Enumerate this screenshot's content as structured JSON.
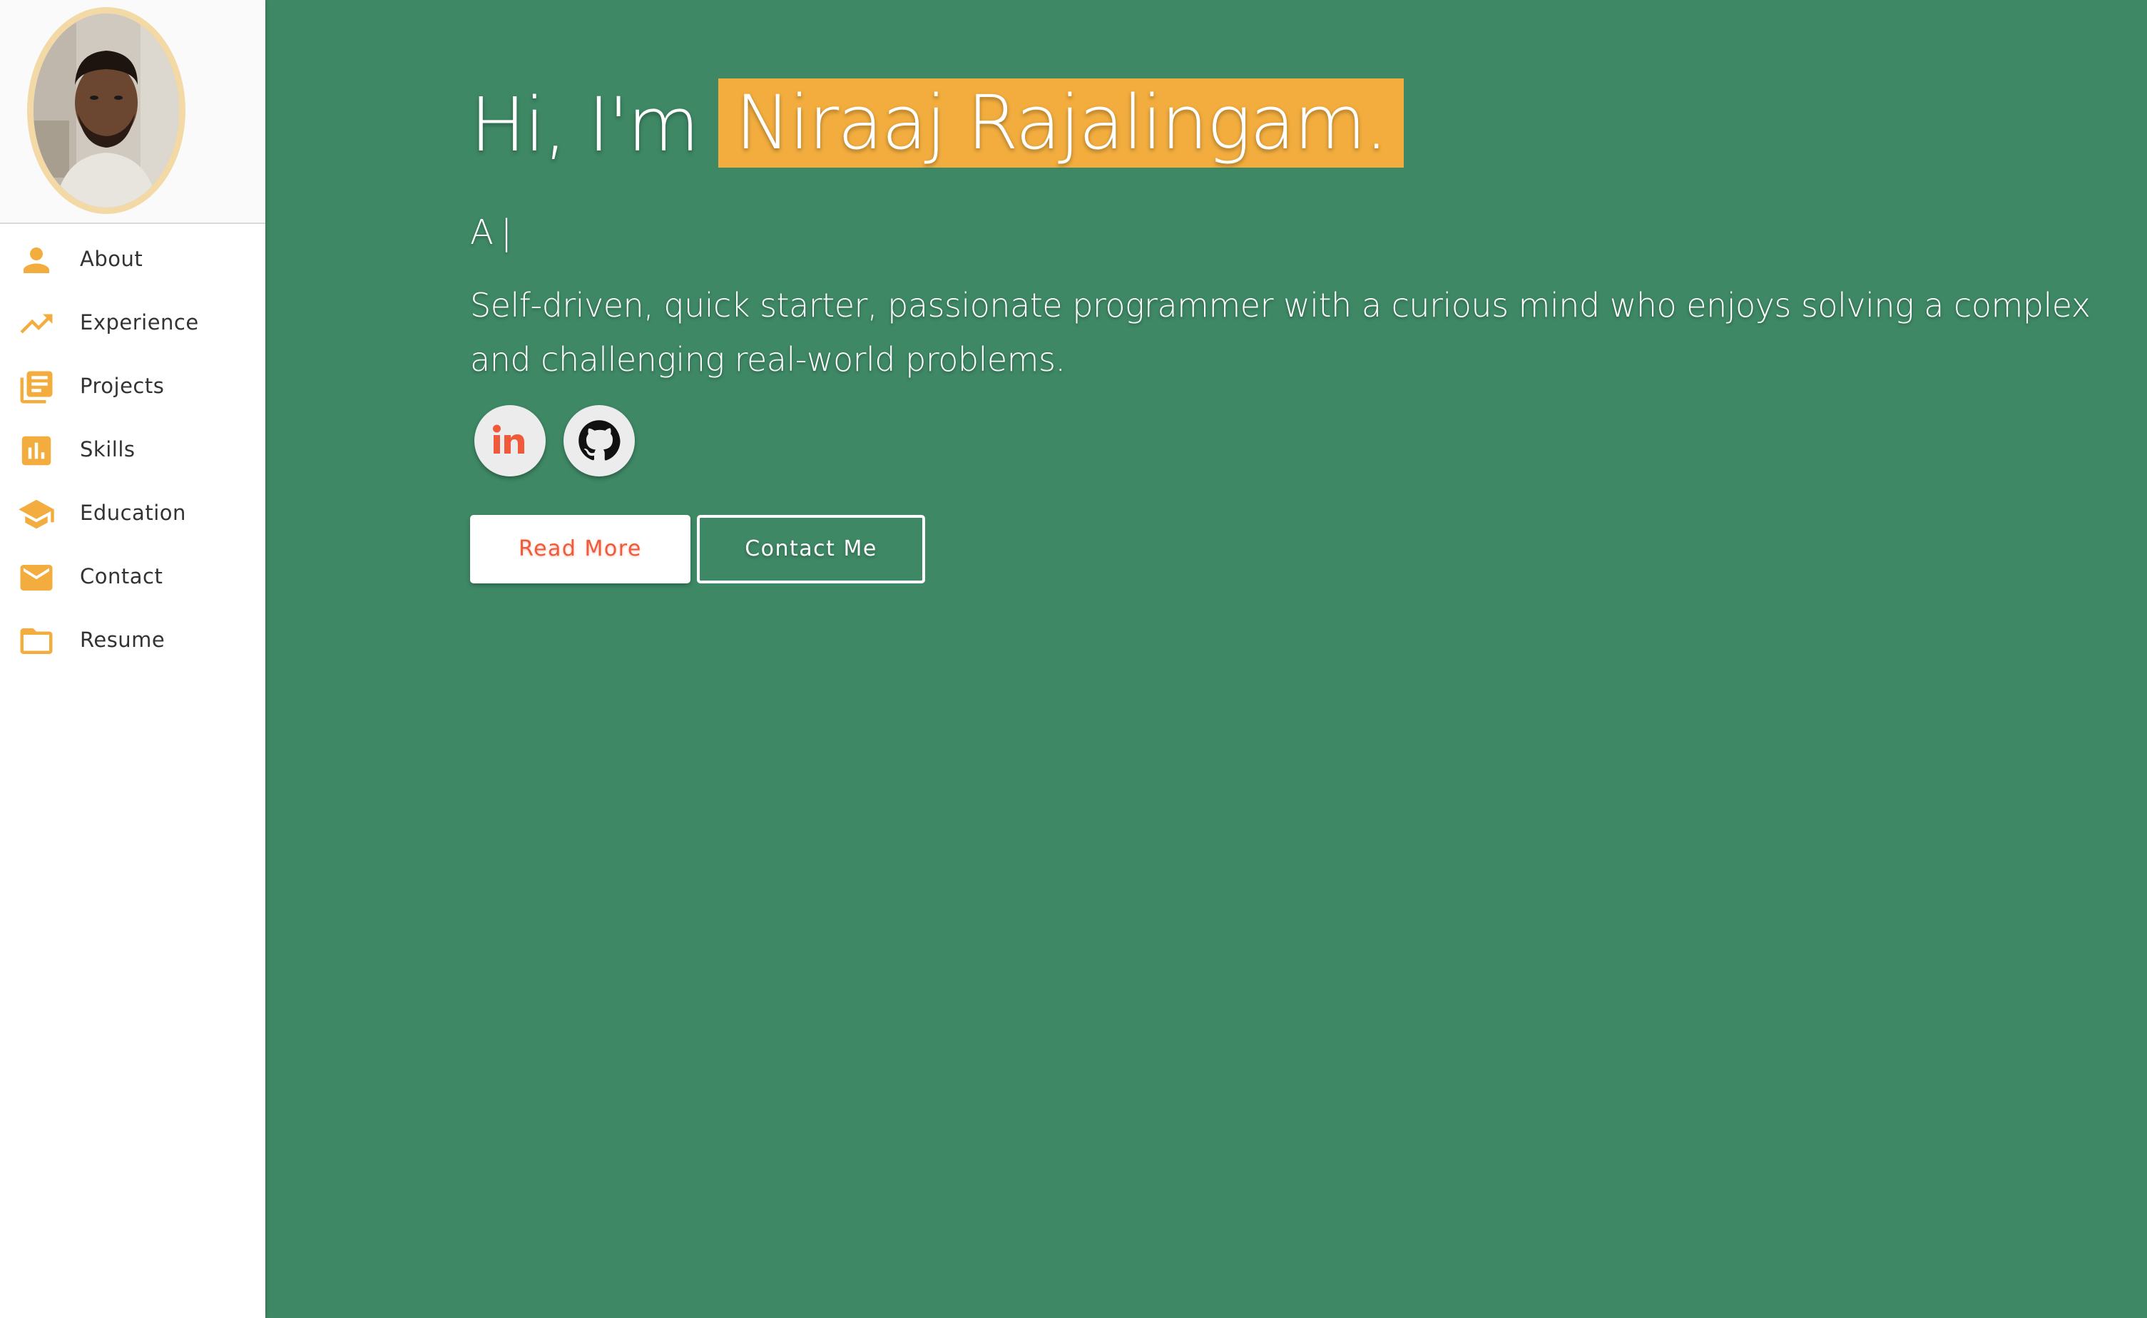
{
  "theme": {
    "background": "#3e8865",
    "accent": "#f2ad3e",
    "link_red": "#f05a3a",
    "sidebar_bg": "#ffffff"
  },
  "sidebar": {
    "avatar_alt": "profile photo",
    "items": [
      {
        "label": "About",
        "icon": "person-icon"
      },
      {
        "label": "Experience",
        "icon": "trending-up-icon"
      },
      {
        "label": "Projects",
        "icon": "library-books-icon"
      },
      {
        "label": "Skills",
        "icon": "bar-chart-icon"
      },
      {
        "label": "Education",
        "icon": "school-cap-icon"
      },
      {
        "label": "Contact",
        "icon": "envelope-icon"
      },
      {
        "label": "Resume",
        "icon": "folder-icon"
      }
    ]
  },
  "hero": {
    "greeting": "Hi, I'm",
    "name": "Niraaj Rajalingam.",
    "typed_text": "A",
    "typed_cursor": "|",
    "bio": "Self-driven, quick starter, passionate programmer with a curious mind who enjoys solving a complex and challenging real-world problems."
  },
  "social": [
    {
      "name": "linkedin",
      "icon": "linkedin-icon"
    },
    {
      "name": "github",
      "icon": "github-icon"
    }
  ],
  "buttons": {
    "read_more": "Read More",
    "contact_me": "Contact Me"
  }
}
